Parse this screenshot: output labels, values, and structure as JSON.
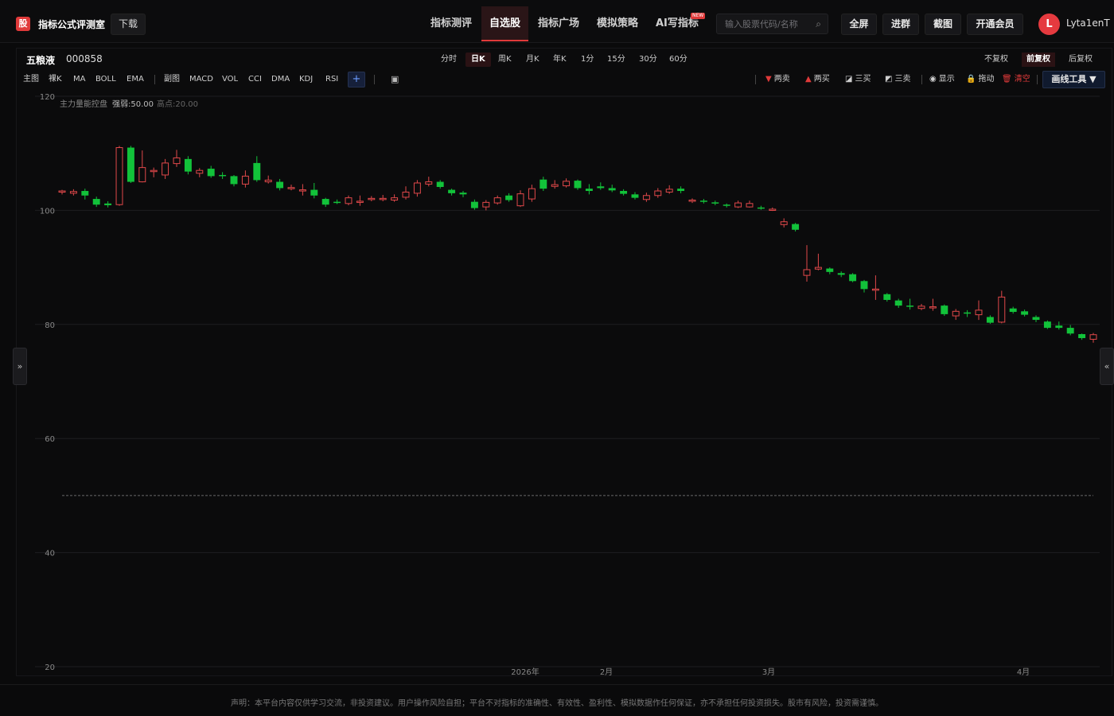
{
  "brand": {
    "logo_text": "股",
    "name": "指标公式评测室",
    "download": "下载"
  },
  "nav": [
    {
      "label": "指标测评",
      "active": false
    },
    {
      "label": "自选股",
      "active": true
    },
    {
      "label": "指标广场",
      "active": false
    },
    {
      "label": "模拟策略",
      "active": false
    },
    {
      "label": "AI写指标",
      "active": false,
      "badge": "NEW"
    }
  ],
  "search": {
    "placeholder": "输入股票代码/名称",
    "icon": "search-icon"
  },
  "top_buttons": [
    "全屏",
    "进群",
    "截图",
    "开通会员"
  ],
  "user": {
    "initial": "L",
    "name": "Lyta1enT"
  },
  "stock": {
    "name": "五粮液",
    "code": "000858"
  },
  "periods": [
    {
      "label": "分时",
      "active": false
    },
    {
      "label": "日K",
      "active": true
    },
    {
      "label": "周K",
      "active": false
    },
    {
      "label": "月K",
      "active": false
    },
    {
      "label": "年K",
      "active": false
    },
    {
      "label": "1分",
      "active": false
    },
    {
      "label": "15分",
      "active": false
    },
    {
      "label": "30分",
      "active": false
    },
    {
      "label": "60分",
      "active": false
    }
  ],
  "adjust": [
    {
      "label": "不复权",
      "active": false
    },
    {
      "label": "前复权",
      "active": true
    },
    {
      "label": "后复权",
      "active": false
    }
  ],
  "indicators_main": [
    "主图",
    "裸K",
    "MA",
    "BOLL",
    "EMA"
  ],
  "indicators_sub": [
    "副图",
    "MACD",
    "VOL",
    "CCI",
    "DMA",
    "KDJ",
    "RSI"
  ],
  "add_label": "+",
  "draw_items": [
    {
      "icon": "▼",
      "label": "两卖",
      "color": "#e03a3a"
    },
    {
      "icon": "▲",
      "label": "两买",
      "color": "#e03a3a"
    },
    {
      "icon": "◪",
      "label": "三买",
      "color": "#dddddd"
    },
    {
      "icon": "◩",
      "label": "三卖",
      "color": "#dddddd"
    },
    {
      "icon": "◉",
      "label": "显示",
      "color": "#dddddd"
    },
    {
      "icon": "🔒",
      "label": "拖动",
      "color": "#dddddd"
    },
    {
      "icon": "🗑",
      "label": "清空",
      "color": "#e03a3a"
    }
  ],
  "draw_tool_label": "画线工具 ▼",
  "side_left": "»",
  "side_right": "«",
  "footer": "声明：本平台内容仅供学习交流，非投资建议。用户操作风险自担；平台不对指标的准确性、有效性、盈利性、模拟数据作任何保证，亦不承担任何投资损失。股市有风险，投资需谨慎。",
  "colors": {
    "up": "#e0484a",
    "down": "#12c23a",
    "accent": "#e03a3a"
  },
  "chart_data": {
    "type": "candlestick",
    "indicator_label": "主力量能控盘",
    "indicator_values": [
      {
        "label": "强弱:50.00",
        "color": "#bbbbbb"
      },
      {
        "label": "高点:20.00",
        "color": "#666666"
      }
    ],
    "ylim": [
      20,
      120
    ],
    "yticks": [
      120,
      100,
      80,
      60,
      40,
      20
    ],
    "reference_line": 50,
    "xticks": [
      "2026年",
      "2月",
      "3月",
      "4月"
    ],
    "candles": [
      [
        103.2,
        103.4,
        103.6,
        102.8
      ],
      [
        103.0,
        103.3,
        103.7,
        102.6
      ],
      [
        103.4,
        102.6,
        103.8,
        101.9
      ],
      [
        102.0,
        101.0,
        102.4,
        100.6
      ],
      [
        101.2,
        100.9,
        101.6,
        100.5
      ],
      [
        101.0,
        111.0,
        111.3,
        100.8
      ],
      [
        111.0,
        105.0,
        111.3,
        104.8
      ],
      [
        105.0,
        107.5,
        110.5,
        104.9
      ],
      [
        106.8,
        107.0,
        107.5,
        105.8
      ],
      [
        106.2,
        108.3,
        109.0,
        105.5
      ],
      [
        108.2,
        109.2,
        110.6,
        107.6
      ],
      [
        109.0,
        106.8,
        109.5,
        106.3
      ],
      [
        106.5,
        107.0,
        107.4,
        105.8
      ],
      [
        107.3,
        106.0,
        107.8,
        105.7
      ],
      [
        106.2,
        106.0,
        106.7,
        105.5
      ],
      [
        106.0,
        104.6,
        106.2,
        104.2
      ],
      [
        104.6,
        106.0,
        107.0,
        104.0
      ],
      [
        108.3,
        105.3,
        109.5,
        105.0
      ],
      [
        105.0,
        105.3,
        106.1,
        104.7
      ],
      [
        105.0,
        103.9,
        105.5,
        103.5
      ],
      [
        103.8,
        104.0,
        104.5,
        103.5
      ],
      [
        103.4,
        103.6,
        104.6,
        102.6
      ],
      [
        103.6,
        102.6,
        104.8,
        102.1
      ],
      [
        102.0,
        101.0,
        102.2,
        100.6
      ],
      [
        101.5,
        101.4,
        101.9,
        101.1
      ],
      [
        101.2,
        102.2,
        102.6,
        100.9
      ],
      [
        101.4,
        101.6,
        102.6,
        100.8
      ],
      [
        101.9,
        102.1,
        102.5,
        101.6
      ],
      [
        101.9,
        102.1,
        102.7,
        101.6
      ],
      [
        101.8,
        102.2,
        102.8,
        101.5
      ],
      [
        102.3,
        103.2,
        104.2,
        101.9
      ],
      [
        103.0,
        104.8,
        105.3,
        102.4
      ],
      [
        104.6,
        105.0,
        105.9,
        104.2
      ],
      [
        105.0,
        104.1,
        105.3,
        103.8
      ],
      [
        103.6,
        103.0,
        103.8,
        102.6
      ],
      [
        103.1,
        102.8,
        103.4,
        102.3
      ],
      [
        101.5,
        100.4,
        101.9,
        100.1
      ],
      [
        100.6,
        101.4,
        101.8,
        100.0
      ],
      [
        101.3,
        102.2,
        102.6,
        101.0
      ],
      [
        102.6,
        101.8,
        103.0,
        101.5
      ],
      [
        100.8,
        102.9,
        103.5,
        100.6
      ],
      [
        102.0,
        103.8,
        104.5,
        101.5
      ],
      [
        105.4,
        103.8,
        105.9,
        103.4
      ],
      [
        104.2,
        104.5,
        105.3,
        103.8
      ],
      [
        104.3,
        105.1,
        105.6,
        104.0
      ],
      [
        105.2,
        103.9,
        105.4,
        103.6
      ],
      [
        103.8,
        103.4,
        104.6,
        102.8
      ],
      [
        104.2,
        103.9,
        104.9,
        103.6
      ],
      [
        103.9,
        103.5,
        104.5,
        103.2
      ],
      [
        103.4,
        102.9,
        103.7,
        102.6
      ],
      [
        102.8,
        102.2,
        103.2,
        101.9
      ],
      [
        101.9,
        102.6,
        103.1,
        101.5
      ],
      [
        102.6,
        103.4,
        103.9,
        102.2
      ],
      [
        103.2,
        103.7,
        104.4,
        102.9
      ],
      [
        103.8,
        103.4,
        104.2,
        103.0
      ],
      [
        101.6,
        101.8,
        102.1,
        101.3
      ],
      [
        101.7,
        101.5,
        102.0,
        101.2
      ],
      [
        101.4,
        101.2,
        101.7,
        100.9
      ],
      [
        101.0,
        100.8,
        101.2,
        100.5
      ],
      [
        100.6,
        101.3,
        101.7,
        100.4
      ],
      [
        100.6,
        101.2,
        101.7,
        100.5
      ],
      [
        100.5,
        100.3,
        100.8,
        100.1
      ],
      [
        100.1,
        100.2,
        100.5,
        99.9
      ],
      [
        97.5,
        98.0,
        98.6,
        97.0
      ],
      [
        97.6,
        96.6,
        97.8,
        96.3
      ],
      [
        88.6,
        89.6,
        93.9,
        87.5
      ],
      [
        89.7,
        90.0,
        92.4,
        89.5
      ],
      [
        89.8,
        89.2,
        90.0,
        88.8
      ],
      [
        89.0,
        88.7,
        89.3,
        88.3
      ],
      [
        88.8,
        87.6,
        89.0,
        87.4
      ],
      [
        87.6,
        86.2,
        87.8,
        85.6
      ],
      [
        86.0,
        86.2,
        88.6,
        84.3
      ],
      [
        85.3,
        84.3,
        85.5,
        84.0
      ],
      [
        84.2,
        83.3,
        84.5,
        82.9
      ],
      [
        83.3,
        83.2,
        84.5,
        82.6
      ],
      [
        82.8,
        83.2,
        83.6,
        82.5
      ],
      [
        82.9,
        83.1,
        84.5,
        82.4
      ],
      [
        83.3,
        81.8,
        83.5,
        81.5
      ],
      [
        81.5,
        82.3,
        82.7,
        80.8
      ],
      [
        82.1,
        81.9,
        82.5,
        81.3
      ],
      [
        81.7,
        82.5,
        84.2,
        80.8
      ],
      [
        81.3,
        80.3,
        81.6,
        80.1
      ],
      [
        80.4,
        84.8,
        85.9,
        80.2
      ],
      [
        82.8,
        82.2,
        83.1,
        81.9
      ],
      [
        82.3,
        81.7,
        82.6,
        81.4
      ],
      [
        81.3,
        80.8,
        81.6,
        80.4
      ],
      [
        80.5,
        79.4,
        80.7,
        79.2
      ],
      [
        79.8,
        79.4,
        80.5,
        79.1
      ],
      [
        79.4,
        78.4,
        79.9,
        78.1
      ],
      [
        78.3,
        77.6,
        78.4,
        77.3
      ],
      [
        77.4,
        78.2,
        78.5,
        76.8
      ]
    ]
  }
}
